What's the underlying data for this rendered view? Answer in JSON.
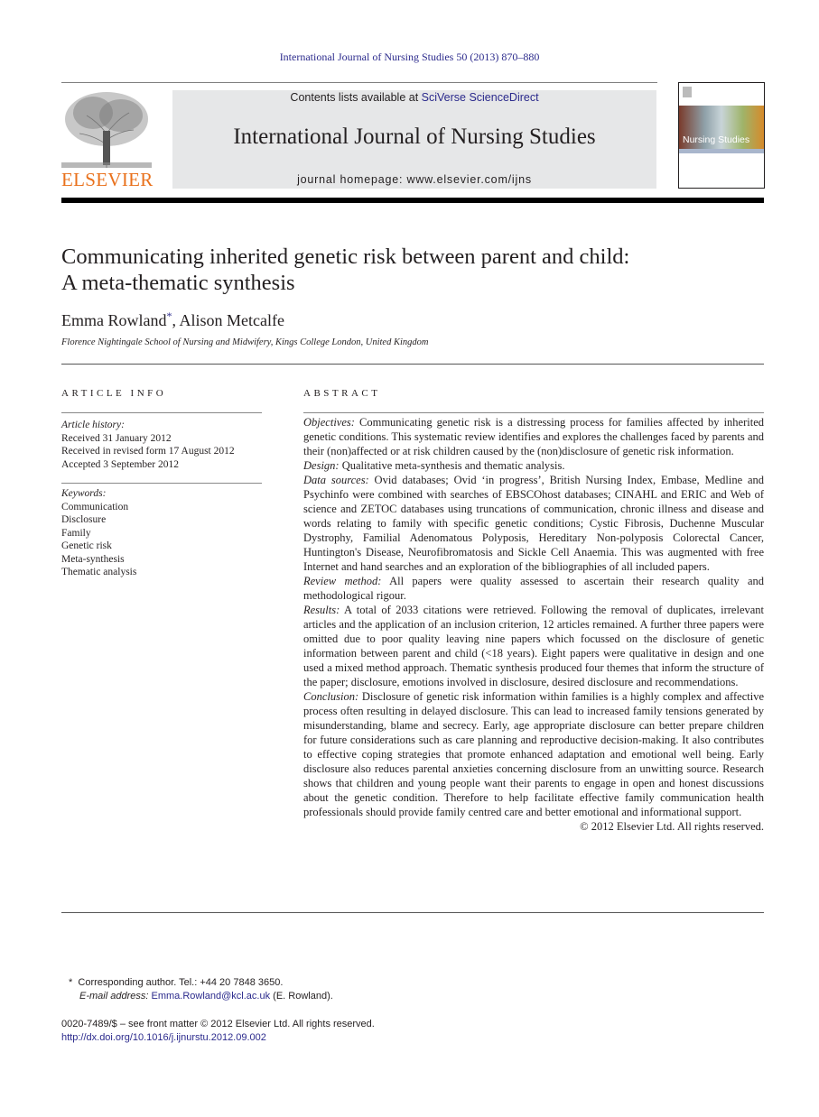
{
  "running_head": "International Journal of Nursing Studies 50 (2013) 870–880",
  "header": {
    "publisher_logo_text": "ELSEVIER",
    "contents_prefix": "Contents lists available at ",
    "contents_link": "SciVerse ScienceDirect",
    "journal_title": "International Journal of Nursing Studies",
    "homepage_prefix": "journal homepage: ",
    "homepage_url": "www.elsevier.com/ijns",
    "cover_title": "Nursing Studies"
  },
  "article": {
    "title_line1": "Communicating inherited genetic risk between parent and child:",
    "title_line2": "A meta-thematic synthesis",
    "author1": "Emma Rowland",
    "author1_mark": "*",
    "author_sep": ", ",
    "author2": "Alison Metcalfe",
    "affiliation": "Florence Nightingale School of Nursing and Midwifery, Kings College London, United Kingdom"
  },
  "article_info": {
    "heading": "ARTICLE INFO",
    "history_label": "Article history:",
    "history": [
      "Received 31 January 2012",
      "Received in revised form 17 August 2012",
      "Accepted 3 September 2012"
    ],
    "keywords_label": "Keywords:",
    "keywords": [
      "Communication",
      "Disclosure",
      "Family",
      "Genetic risk",
      "Meta-synthesis",
      "Thematic analysis"
    ]
  },
  "abstract": {
    "heading": "ABSTRACT",
    "sections": [
      {
        "label": "Objectives:",
        "text": "Communicating genetic risk is a distressing process for families affected by inherited genetic conditions. This systematic review identifies and explores the challenges faced by parents and their (non)affected or at risk children caused by the (non)disclosure of genetic risk information."
      },
      {
        "label": "Design:",
        "text": "Qualitative meta-synthesis and thematic analysis."
      },
      {
        "label": "Data sources:",
        "text": "Ovid databases; Ovid ‘in progress’, British Nursing Index, Embase, Medline and Psychinfo were combined with searches of EBSCOhost databases; CINAHL and ERIC and Web of science and ZETOC databases using truncations of communication, chronic illness and disease and words relating to family with specific genetic conditions; Cystic Fibrosis, Duchenne Muscular Dystrophy, Familial Adenomatous Polyposis, Hereditary Non-polyposis Colorectal Cancer, Huntington's Disease, Neurofibromatosis and Sickle Cell Anaemia. This was augmented with free Internet and hand searches and an exploration of the bibliographies of all included papers."
      },
      {
        "label": "Review method:",
        "text": "All papers were quality assessed to ascertain their research quality and methodological rigour."
      },
      {
        "label": "Results:",
        "text": "A total of 2033 citations were retrieved. Following the removal of duplicates, irrelevant articles and the application of an inclusion criterion, 12 articles remained. A further three papers were omitted due to poor quality leaving nine papers which focussed on the disclosure of genetic information between parent and child (<18 years). Eight papers were qualitative in design and one used a mixed method approach. Thematic synthesis produced four themes that inform the structure of the paper; disclosure, emotions involved in disclosure, desired disclosure and recommendations."
      },
      {
        "label": "Conclusion:",
        "text": "Disclosure of genetic risk information within families is a highly complex and affective process often resulting in delayed disclosure. This can lead to increased family tensions generated by misunderstanding, blame and secrecy. Early, age appropriate disclosure can better prepare children for future considerations such as care planning and reproductive decision-making. It also contributes to effective coping strategies that promote enhanced adaptation and emotional well being. Early disclosure also reduces parental anxieties concerning disclosure from an unwitting source. Research shows that children and young people want their parents to engage in open and honest discussions about the genetic condition. Therefore to help facilitate effective family communication health professionals should provide family centred care and better emotional and informational support."
      }
    ],
    "copyright": "© 2012 Elsevier Ltd. All rights reserved."
  },
  "footnote": {
    "mark": "*",
    "corresponding": "Corresponding author. Tel.: +44 20 7848 3650.",
    "email_label": "E-mail address:",
    "email": "Emma.Rowland@kcl.ac.uk",
    "email_suffix": " (E. Rowland)."
  },
  "front_matter": {
    "issn_line": "0020-7489/$ – see front matter © 2012 Elsevier Ltd. All rights reserved.",
    "doi": "http://dx.doi.org/10.1016/j.ijnurstu.2012.09.002"
  }
}
